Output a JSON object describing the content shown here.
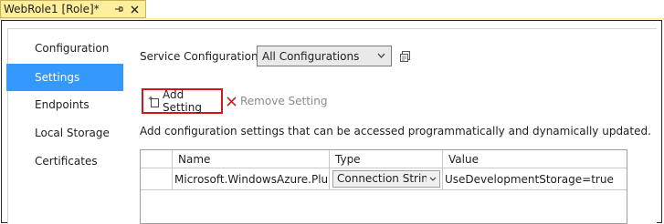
{
  "tab": {
    "title": "WebRole1 [Role]*",
    "pin_glyph": "⊸",
    "close_glyph": "✕"
  },
  "nav": {
    "items": [
      {
        "label": "Configuration",
        "selected": false
      },
      {
        "label": "Settings",
        "selected": true
      },
      {
        "label": "Endpoints",
        "selected": false
      },
      {
        "label": "Local Storage",
        "selected": false
      },
      {
        "label": "Certificates",
        "selected": false
      }
    ]
  },
  "service_config": {
    "label": "Service Configuration:",
    "selected": "All Configurations"
  },
  "toolbar": {
    "add_label": "Add Setting",
    "remove_label": "Remove Setting"
  },
  "description": "Add configuration settings that can be accessed programmatically and dynamically updated.",
  "grid": {
    "headers": [
      "Name",
      "Type",
      "Value"
    ],
    "rows": [
      {
        "name": "Microsoft.WindowsAzure.Plu...",
        "type": "Connection String",
        "value": "UseDevelopmentStorage=true"
      }
    ]
  },
  "colors": {
    "tab_bg": "#ffef9c",
    "selection": "#3399ff",
    "highlight_border": "#d4151a",
    "remove_icon": "#cc1f1f"
  }
}
